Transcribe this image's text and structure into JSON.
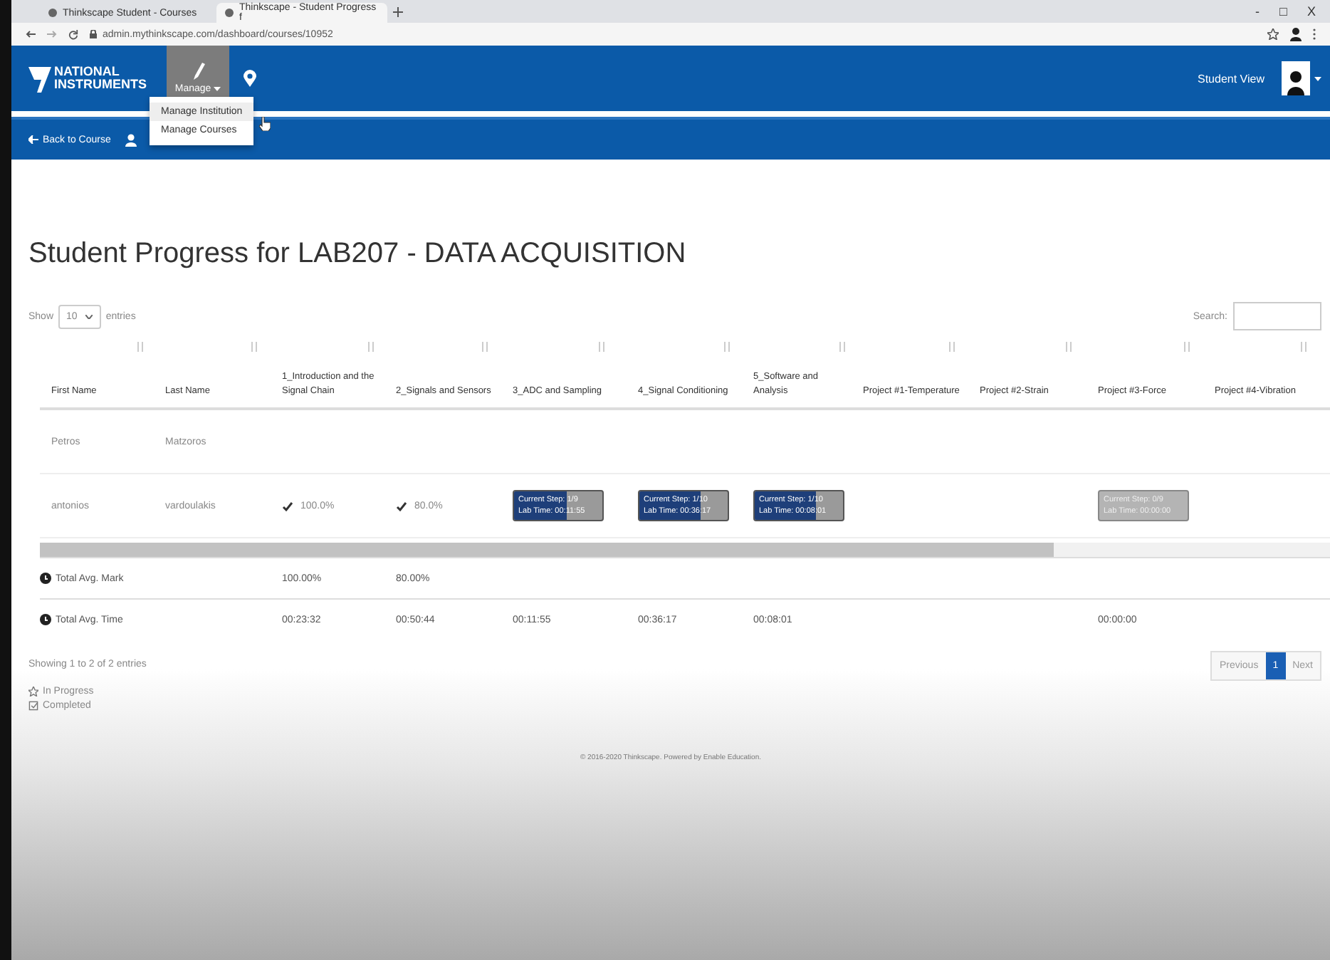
{
  "browser": {
    "tabs": [
      {
        "title": "Thinkscape Student - Courses",
        "selected": false
      },
      {
        "title": "Thinkscape - Student Progress f",
        "selected": true
      }
    ],
    "address": "admin.mythinkscape.com/dashboard/courses/10952",
    "window_controls": [
      "-",
      "□",
      "X"
    ]
  },
  "navbar": {
    "logo": [
      "NATIONAL",
      "INSTRUMENTS"
    ],
    "manage": {
      "label": "Manage",
      "selected": true
    },
    "student_view": "Student View"
  },
  "subnav": {
    "back": "Back to Course"
  },
  "manage_menu": {
    "items": [
      {
        "label": "Manage Institution",
        "selected": true
      },
      {
        "label": "Manage Courses",
        "selected": false
      }
    ]
  },
  "title": "Student Progress for LAB207 - DATA ACQUISITION",
  "length": {
    "show": "Show",
    "value": "10",
    "entries": "entries"
  },
  "search": {
    "label": "Search:"
  },
  "table": {
    "columns": [
      "First Name",
      "Last Name",
      "1_Introduction and the Signal Chain",
      "2_Signals and Sensors",
      "3_ADC and Sampling",
      "4_Signal Conditioning",
      "5_Software and Analysis",
      "Project #1-Temperature",
      "Project #2-Strain",
      "Project #3-Force",
      "Project #4-Vibration"
    ],
    "rows": [
      {
        "cells": [
          {
            "kind": "text",
            "text": "Petros"
          },
          {
            "kind": "text",
            "text": "Matzoros"
          },
          {
            "kind": "empty"
          },
          {
            "kind": "empty"
          },
          {
            "kind": "empty"
          },
          {
            "kind": "empty"
          },
          {
            "kind": "empty"
          },
          {
            "kind": "empty"
          },
          {
            "kind": "empty"
          },
          {
            "kind": "empty"
          },
          {
            "kind": "empty"
          }
        ]
      },
      {
        "cells": [
          {
            "kind": "text",
            "text": "antonios"
          },
          {
            "kind": "text",
            "text": "vardoulakis"
          },
          {
            "kind": "grade",
            "text": "100.0%"
          },
          {
            "kind": "grade",
            "text": "80.0%"
          },
          {
            "kind": "step",
            "step": "Current Step: 1/9",
            "time": "Lab Time: 00:11:55",
            "level": 0.6
          },
          {
            "kind": "step",
            "step": "Current Step: 1/10",
            "time": "Lab Time: 00:36:17",
            "level": 0.7
          },
          {
            "kind": "step",
            "step": "Current Step: 1/10",
            "time": "Lab Time: 00:08:01",
            "level": 0.7
          },
          {
            "kind": "empty"
          },
          {
            "kind": "empty"
          },
          {
            "kind": "step",
            "step": "Current Step: 0/9",
            "time": "Lab Time: 00:00:00"
          },
          {
            "kind": "empty"
          }
        ]
      }
    ],
    "totals": [
      {
        "cells": [
          {
            "kind": "label",
            "text": "Total Avg. Mark"
          },
          {
            "kind": "empty"
          },
          {
            "kind": "text",
            "text": "100.00%"
          },
          {
            "kind": "text",
            "text": "80.00%"
          },
          {
            "kind": "empty"
          },
          {
            "kind": "empty"
          },
          {
            "kind": "empty"
          },
          {
            "kind": "empty"
          },
          {
            "kind": "empty"
          },
          {
            "kind": "empty"
          },
          {
            "kind": "empty"
          }
        ]
      },
      {
        "cells": [
          {
            "kind": "label",
            "text": "Total Avg. Time"
          },
          {
            "kind": "empty"
          },
          {
            "kind": "text",
            "text": "00:23:32"
          },
          {
            "kind": "text",
            "text": "00:50:44"
          },
          {
            "kind": "text",
            "text": "00:11:55"
          },
          {
            "kind": "text",
            "text": "00:36:17"
          },
          {
            "kind": "text",
            "text": "00:08:01"
          },
          {
            "kind": "empty"
          },
          {
            "kind": "empty"
          },
          {
            "kind": "text",
            "text": "00:00:00"
          },
          {
            "kind": "empty"
          }
        ]
      }
    ]
  },
  "info": "Showing 1 to 2 of 2 entries",
  "pagination": [
    {
      "label": "Previous",
      "selected": false
    },
    {
      "label": "1",
      "selected": true
    },
    {
      "label": "Next",
      "selected": false
    }
  ],
  "legend": [
    {
      "kind": "star",
      "label": "In Progress"
    },
    {
      "kind": "check",
      "label": "Completed"
    }
  ],
  "footer": "© 2016-2020 Thinkscape. Powered by Enable Education."
}
